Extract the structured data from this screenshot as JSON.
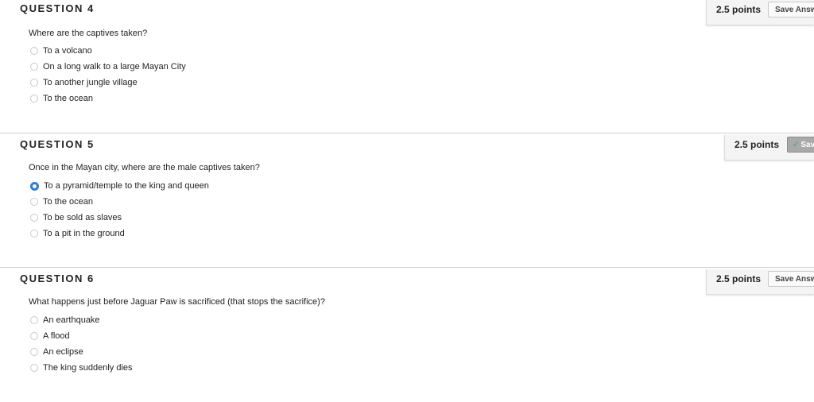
{
  "questions": [
    {
      "title": "QUESTION 4",
      "points": "2.5 points",
      "save_label": "Save Answer",
      "saved": false,
      "text": "Where are the captives taken?",
      "options": [
        "To a volcano",
        "On a long walk to a large Mayan City",
        "To another jungle village",
        "To the ocean"
      ],
      "selected_index": null
    },
    {
      "title": "QUESTION 5",
      "points": "2.5 points",
      "save_label": "Saved",
      "saved": true,
      "text": "Once in the Mayan city, where are the male captives taken?",
      "options": [
        "To a pyramid/temple to the king and queen",
        "To the ocean",
        "To be sold as slaves",
        "To a pit in the ground"
      ],
      "selected_index": 0
    },
    {
      "title": "QUESTION 6",
      "points": "2.5 points",
      "save_label": "Save Answer",
      "saved": false,
      "text": "What happens just before Jaguar Paw is sacrificed (that stops the sacrifice)?",
      "options": [
        "An earthquake",
        "A flood",
        "An eclipse",
        "The king suddenly dies"
      ],
      "selected_index": null
    }
  ],
  "colors": {
    "radio_selected": "#2a7fd4",
    "saved_button_bg": "#a9a9a9",
    "check": "#37b24d"
  },
  "icons": {
    "saved_check": "check-icon"
  }
}
